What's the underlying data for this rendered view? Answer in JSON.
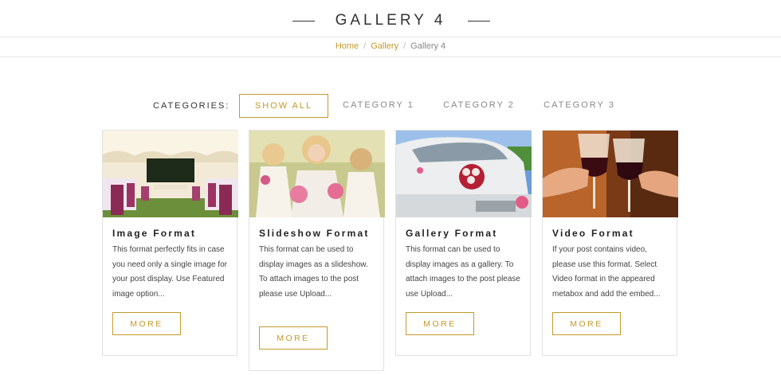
{
  "header": {
    "title": "GALLERY 4"
  },
  "breadcrumb": {
    "home": "Home",
    "gallery": "Gallery",
    "current": "Gallery 4",
    "separator": "/"
  },
  "filters": {
    "label": "CATEGORIES:",
    "items": [
      "SHOW ALL",
      "CATEGORY 1",
      "CATEGORY 2",
      "CATEGORY 3"
    ],
    "active": "SHOW ALL"
  },
  "cards": [
    {
      "title": "Image Format",
      "image": "wedding-tent-photo",
      "description": "This format perfectly fits in case you need only a single image for your post display. Use Featured image option...",
      "more_label": "MORE"
    },
    {
      "title": "Slideshow Format",
      "image": "bridesmaids-photo",
      "description": "This format can be used to display images as a slideshow. To attach images to the post please use Upload...",
      "more_label": "MORE"
    },
    {
      "title": "Gallery Format",
      "image": "wedding-car-photo",
      "description": "This format can be used to display images as a gallery. To attach images to the post please use Upload...",
      "more_label": "MORE"
    },
    {
      "title": "Video Format",
      "image": "wine-glasses-photo",
      "description": "If your post contains video, please use this format. Select Video format in the appeared metabox and add the embed...",
      "more_label": "MORE"
    }
  ],
  "colors": {
    "accent": "#c49a2c",
    "text_dark": "#222222",
    "border": "#e2e2e2"
  }
}
